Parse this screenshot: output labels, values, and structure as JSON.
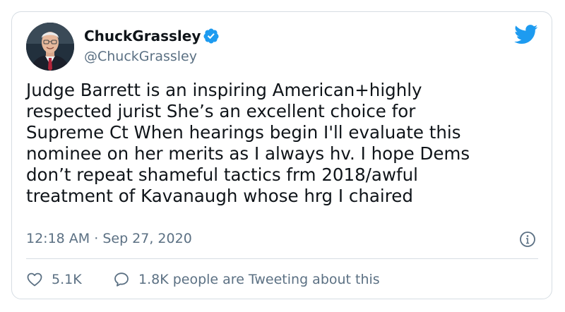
{
  "tweet": {
    "author": {
      "display_name": "ChuckGrassley",
      "handle": "@ChuckGrassley",
      "verified": true,
      "verified_icon": "verified-badge-icon",
      "avatar_icon": "avatar-photo"
    },
    "platform_icon": "twitter-bird-icon",
    "text": "Judge Barrett is an inspiring American+highly\nrespected jurist She’s an excellent choice for\nSupreme Ct When hearings begin I'll evaluate this\nnominee on her merits as I always hv. I hope Dems\ndon’t repeat shameful tactics frm 2018/awful\ntreatment of Kavanaugh whose hrg I chaired",
    "time": "12:18 AM",
    "separator": "·",
    "date": "Sep 27, 2020",
    "info_icon": "info-icon",
    "actions": {
      "like_icon": "heart-icon",
      "like_count": "5.1K",
      "conversation_icon": "speech-bubble-icon",
      "conversation_text": "1.8K people are Tweeting about this"
    }
  },
  "colors": {
    "text_primary": "#0f1419",
    "text_secondary": "#5b7083",
    "brand_blue": "#1d9bf0",
    "border": "#d6dde3",
    "background": "#ffffff"
  }
}
